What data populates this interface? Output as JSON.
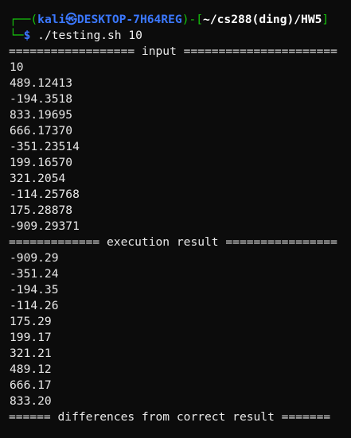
{
  "prompt": {
    "open": "┌──(",
    "user_host": "kali㉿DESKTOP-7H64REG",
    "mid": ")-[",
    "path": "~/cs288(ding)/HW5",
    "close": "]",
    "corner": "└─",
    "dollar": "$",
    "command": " ./testing.sh 10"
  },
  "input_header": "================== input ======================",
  "input_values": [
    "10",
    "489.12413",
    "-194.3518",
    "833.19695",
    "666.17370",
    "-351.23514",
    "199.16570",
    "321.2054",
    "-114.25768",
    "175.28878",
    "-909.29371"
  ],
  "result_header": "============= execution result ================",
  "result_values": [
    "-909.29",
    "-351.24",
    "-194.35",
    "-114.26",
    "175.29",
    "199.17",
    "321.21",
    "489.12",
    "666.17",
    "833.20"
  ],
  "diff_header": "====== differences from correct result ======="
}
